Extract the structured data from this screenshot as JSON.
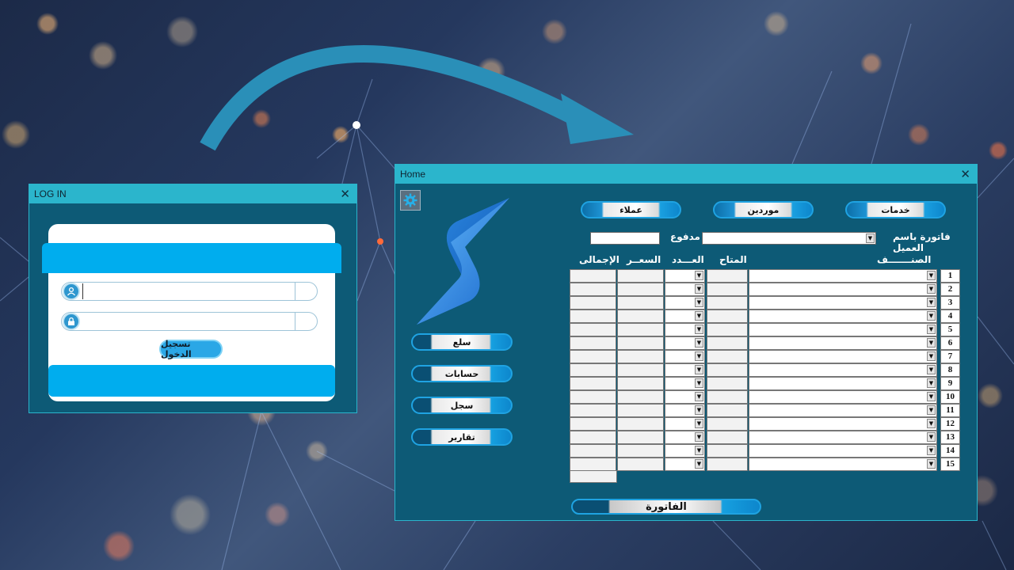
{
  "login": {
    "title": "LOG IN",
    "close": "✕",
    "username_value": "",
    "password_value": "",
    "login_button": "تسجيل الدخول"
  },
  "home": {
    "title": "Home",
    "close": "✕",
    "top_buttons": {
      "customers": "عملاء",
      "suppliers": "موردين",
      "services": "خدمات"
    },
    "side_buttons": {
      "goods": "سلع",
      "accounts": "حسابات",
      "log": "سجل",
      "reports": "تقارير"
    },
    "invoice_customer_label": "فاتورة باسم العميل",
    "paid_label": "مدفوع",
    "paid_value": "",
    "columns": {
      "item": "الصنـــــــف",
      "available": "المتاح",
      "quantity": "العـــدد",
      "price": "السعــر",
      "total": "الإجمالى"
    },
    "rows": [
      "1",
      "2",
      "3",
      "4",
      "5",
      "6",
      "7",
      "8",
      "9",
      "10",
      "11",
      "12",
      "13",
      "14",
      "15"
    ],
    "invoice_button": "الفاتورة"
  },
  "colors": {
    "window_bg": "#0d5a76",
    "titlebar": "#2bb5cc",
    "accent": "#00adee"
  }
}
